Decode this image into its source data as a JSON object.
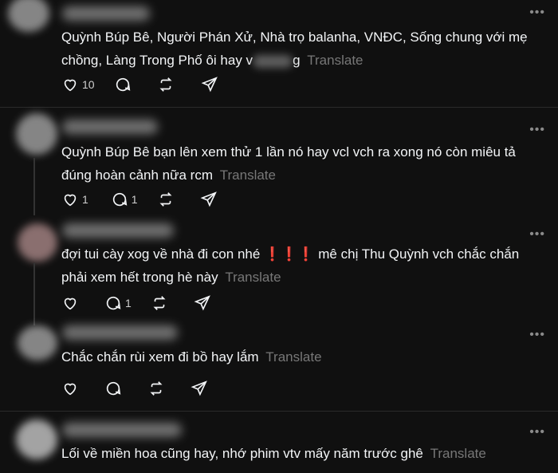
{
  "posts": [
    {
      "text": "Quỳnh Búp Bê, Người Phán Xử, Nhà trọ balanha, VNĐC, Sống chung với mẹ chồng, Làng Trong Phố ôi hay v",
      "text_tail": "g",
      "translate": "Translate",
      "likes": "10",
      "replies": ""
    },
    {
      "text": "Quỳnh Búp Bê bạn lên xem thử 1 lần nó hay vcl vch ra xong nó còn miêu tả đúng hoàn cảnh nữa rcm",
      "translate": "Translate",
      "likes": "1",
      "replies": "1"
    },
    {
      "text_before": "đợi tui cày xog về nhà đi con nhé ",
      "emoji": "❗❗❗",
      "text_after": " mê chị Thu Quỳnh vch chắc chắn phải xem hết trong hè này",
      "translate": "Translate",
      "likes": "",
      "replies": "1"
    },
    {
      "text": "Chắc chắn rùi xem đi bồ hay lắm",
      "translate": "Translate",
      "likes": "",
      "replies": ""
    },
    {
      "text": "Lối về miền hoa cũng hay, nhớ phim vtv mấy năm trước ghê",
      "translate": "Translate"
    }
  ],
  "icons": {
    "like": "heart-icon",
    "reply": "comment-icon",
    "repost": "repost-icon",
    "share": "send-icon",
    "more": "more-icon"
  },
  "colors": {
    "background": "#101010",
    "text": "#f3f5f7",
    "muted": "#777777",
    "emoji_red": "#e0242b"
  },
  "more_glyph": "•••"
}
